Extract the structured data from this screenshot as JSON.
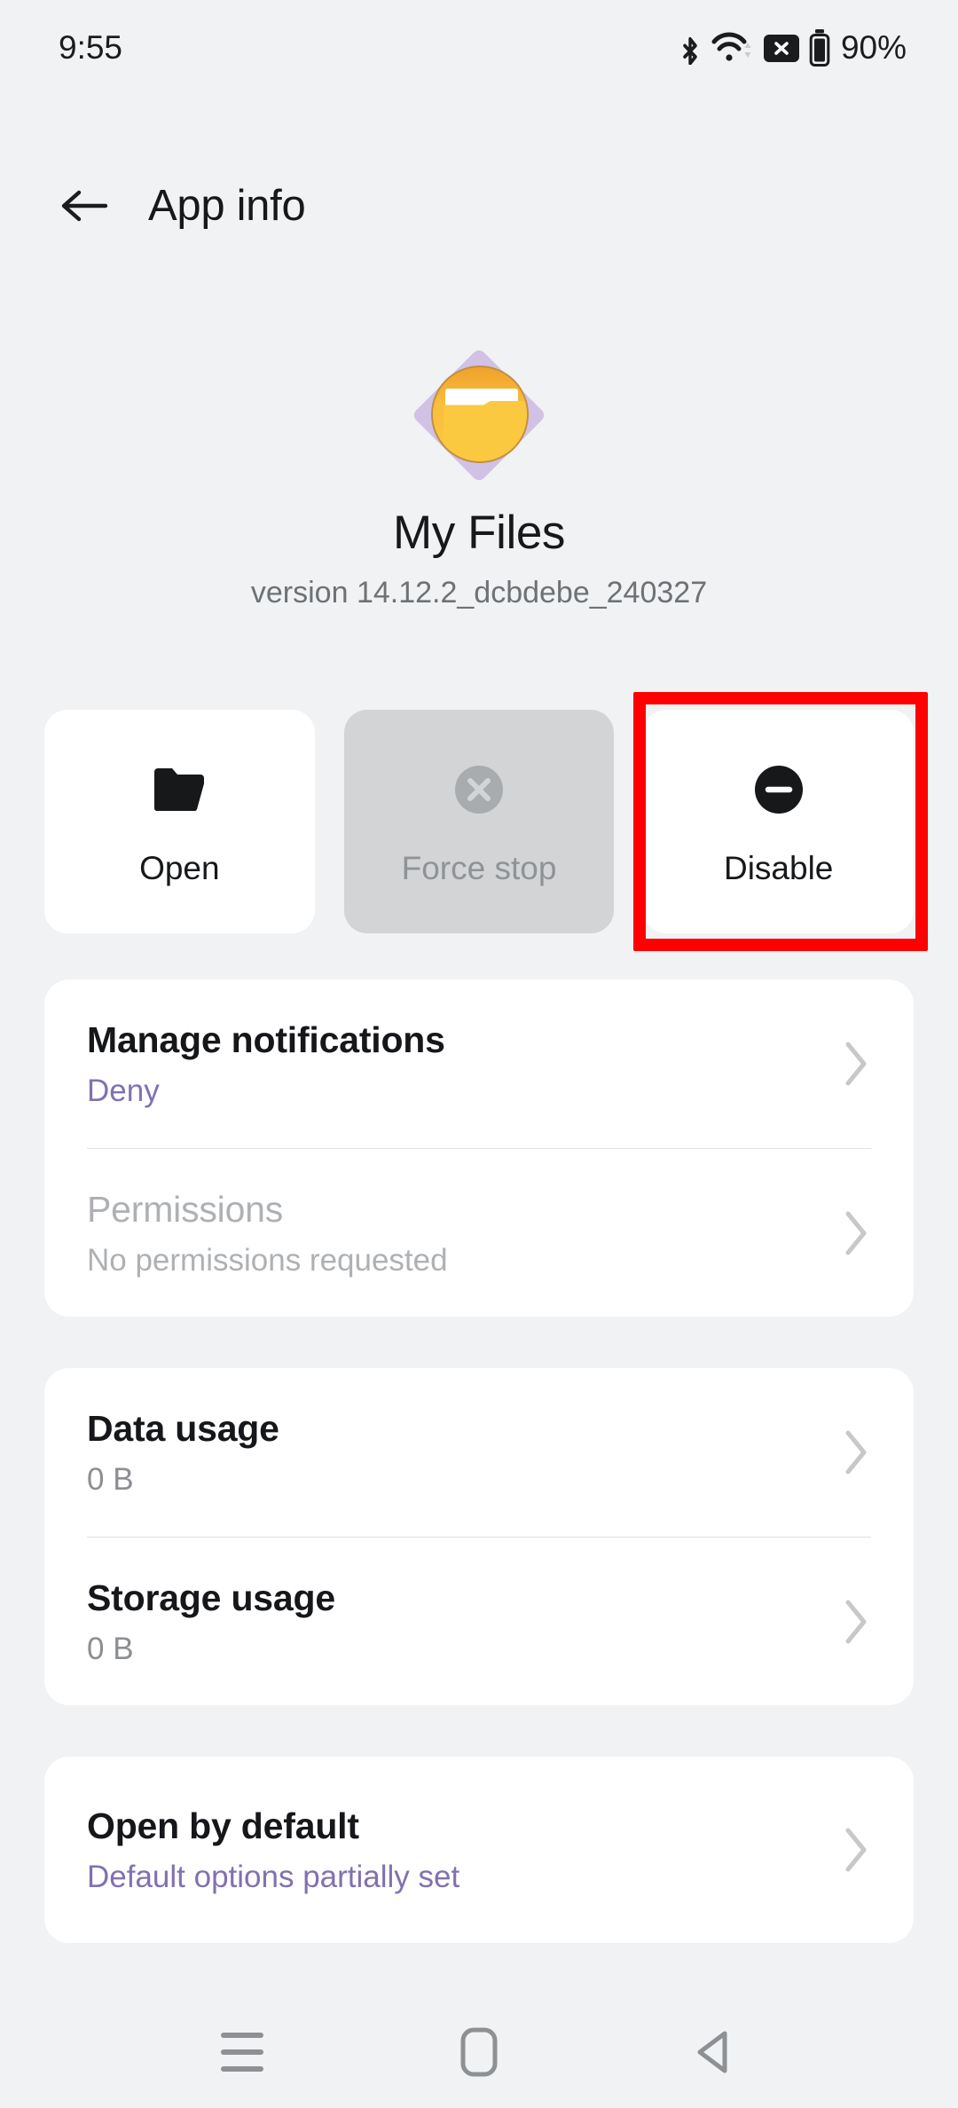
{
  "status_bar": {
    "time": "9:55",
    "battery_percent": "90%",
    "icons": [
      "bluetooth-icon",
      "wifi-icon",
      "no-sim-icon",
      "battery-icon"
    ]
  },
  "app_bar": {
    "back_label": "back-arrow",
    "title": "App info"
  },
  "app_header": {
    "icon_name": "my-files-app-icon",
    "app_name": "My Files",
    "version": "version 14.12.2_dcbdebe_240327"
  },
  "actions": [
    {
      "label": "Open",
      "icon": "folder-icon",
      "enabled": true,
      "highlighted": false
    },
    {
      "label": "Force stop",
      "icon": "x-circle-icon",
      "enabled": false,
      "highlighted": false
    },
    {
      "label": "Disable",
      "icon": "minus-circle-icon",
      "enabled": true,
      "highlighted": true
    }
  ],
  "cards": [
    {
      "rows": [
        {
          "title": "Manage notifications",
          "sub": "Deny",
          "style": "accent"
        },
        {
          "title": "Permissions",
          "sub": "No permissions requested",
          "style": "muted"
        }
      ]
    },
    {
      "rows": [
        {
          "title": "Data usage",
          "sub": "0 B",
          "style": "normal"
        },
        {
          "title": "Storage usage",
          "sub": "0 B",
          "style": "normal"
        }
      ]
    },
    {
      "rows": [
        {
          "title": "Open by default",
          "sub": "Default options partially set",
          "style": "accent"
        }
      ]
    }
  ],
  "nav_bar": {
    "recents_label": "recents-icon",
    "home_label": "home-icon",
    "back_label": "back-icon"
  },
  "colors": {
    "background": "#F0F2F4",
    "card": "#FFFFFF",
    "accent_purple": "#8271B0",
    "highlight_red": "#FE0000",
    "disabled_grey": "#D2D4D6",
    "muted_text": "#8B8E92"
  }
}
